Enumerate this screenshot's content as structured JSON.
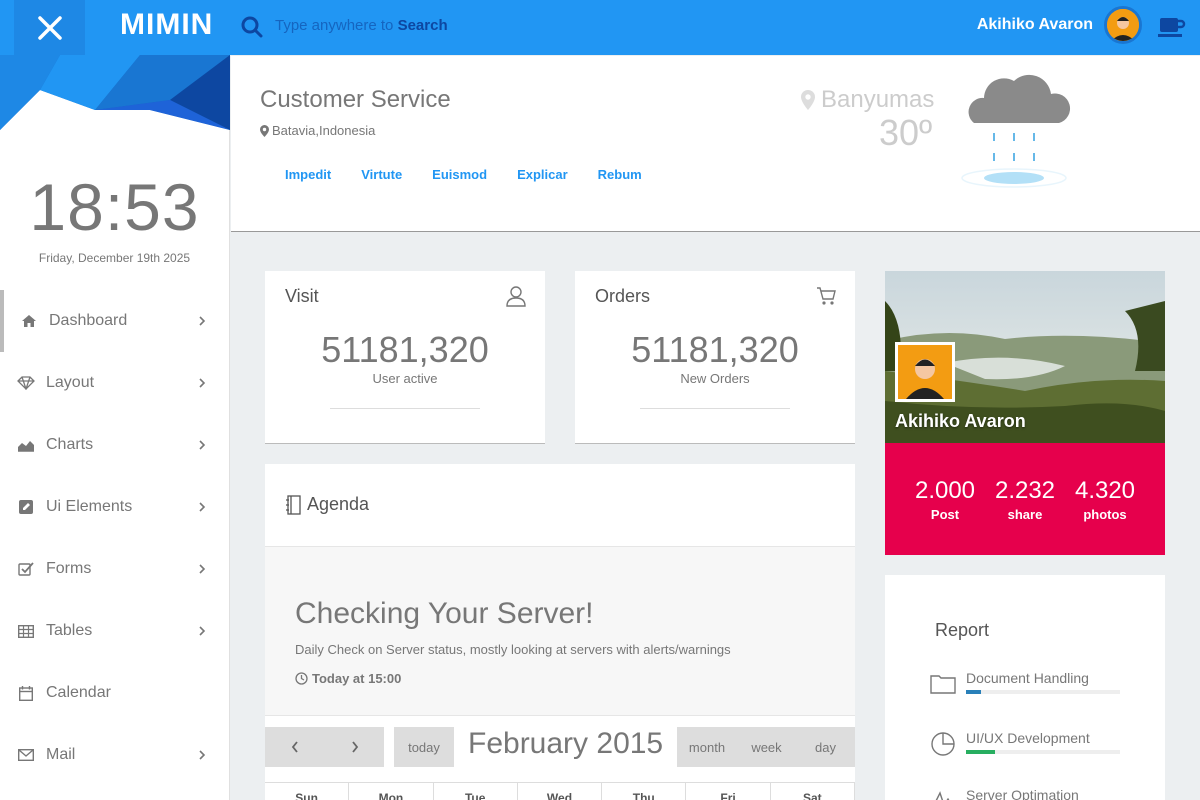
{
  "app": {
    "brand": "MIMIN"
  },
  "search": {
    "placeholder_prefix": "Type anywhere to ",
    "placeholder_bold": "Search"
  },
  "user": {
    "name": "Akihiko Avaron"
  },
  "sidebar": {
    "time": "18:53",
    "date": "Friday, December 19th 2025",
    "items": [
      {
        "label": "Dashboard",
        "icon": "home-icon",
        "active": true,
        "chevron": true
      },
      {
        "label": "Layout",
        "icon": "diamond-icon",
        "chevron": true
      },
      {
        "label": "Charts",
        "icon": "area-chart-icon",
        "chevron": true
      },
      {
        "label": "Ui Elements",
        "icon": "edit-icon",
        "chevron": true
      },
      {
        "label": "Forms",
        "icon": "check-square-icon",
        "chevron": true
      },
      {
        "label": "Tables",
        "icon": "table-icon",
        "chevron": true
      },
      {
        "label": "Calendar",
        "icon": "calendar-icon",
        "chevron": false
      },
      {
        "label": "Mail",
        "icon": "mail-icon",
        "chevron": true
      }
    ]
  },
  "header": {
    "title": "Customer Service",
    "location": "Batavia,Indonesia",
    "tabs": [
      "Impedit",
      "Virtute",
      "Euismod",
      "Explicar",
      "Rebum"
    ]
  },
  "weather": {
    "city": "Banyumas",
    "temp": "30º"
  },
  "stats": {
    "visit": {
      "title": "Visit",
      "value": "51181,320",
      "sub": "User active"
    },
    "orders": {
      "title": "Orders",
      "value": "51181,320",
      "sub": "New Orders"
    }
  },
  "agenda": {
    "title": "Agenda",
    "heading": "Checking Your Server!",
    "desc": "Daily Check on Server status, mostly looking at servers with alerts/warnings",
    "time": "Today at 15:00"
  },
  "calendar": {
    "title": "February 2015",
    "today": "today",
    "views": [
      "month",
      "week",
      "day"
    ],
    "days": [
      "Sun",
      "Mon",
      "Tue",
      "Wed",
      "Thu",
      "Fri",
      "Sat"
    ]
  },
  "profile": {
    "name": "Akihiko Avaron",
    "stats": [
      {
        "value": "2.000",
        "label": "Post"
      },
      {
        "value": "2.232",
        "label": "share"
      },
      {
        "value": "4.320",
        "label": "photos"
      }
    ]
  },
  "report": {
    "title": "Report",
    "items": [
      {
        "label": "Document Handling",
        "progress": 0.1,
        "color": "#2980b9",
        "icon": "folder-icon"
      },
      {
        "label": "UI/UX Development",
        "progress": 0.19,
        "color": "#27ae60",
        "icon": "pie-chart-icon"
      },
      {
        "label": "Server Optimation",
        "progress": 0,
        "color": "#999999",
        "icon": "activity-icon"
      }
    ]
  },
  "colors": {
    "primary": "#2196f3",
    "accent": "#e6004c"
  }
}
